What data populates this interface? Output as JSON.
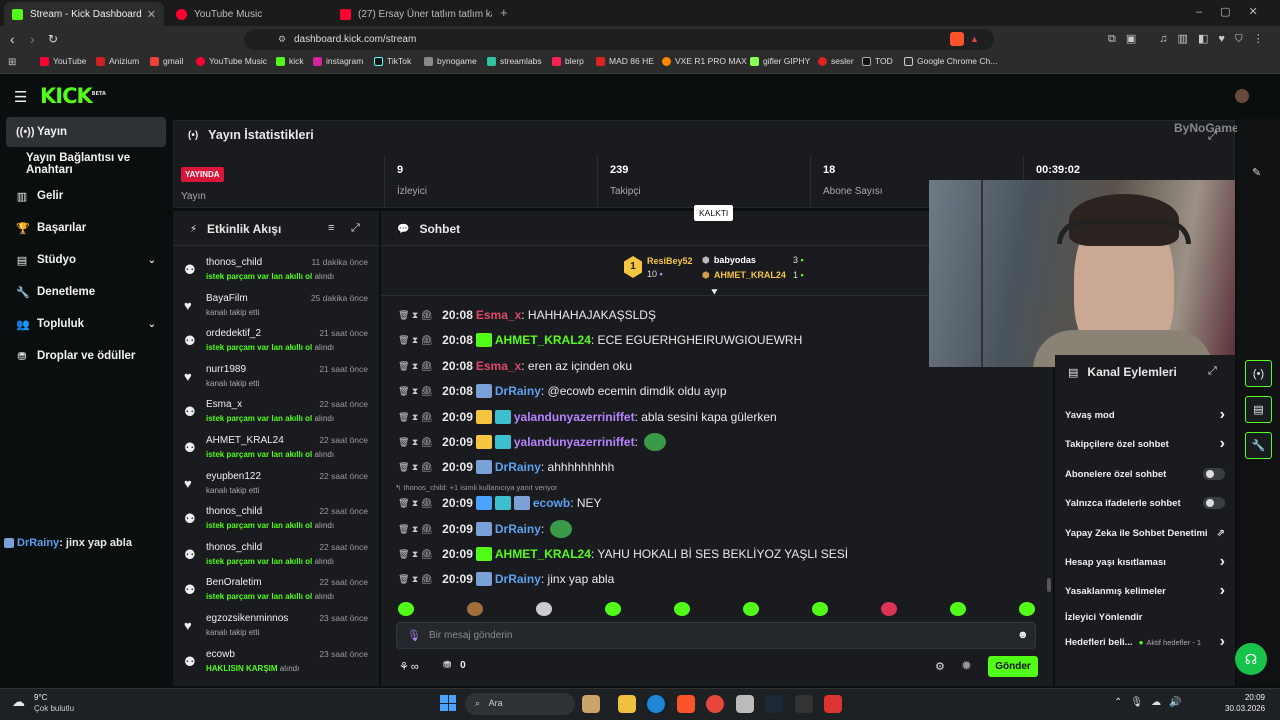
{
  "browser": {
    "tabs": [
      {
        "title": "Stream - Kick Dashboard",
        "color": "#53fc18"
      },
      {
        "title": "YouTube Music",
        "color": "#ff0033"
      },
      {
        "title": "(27) Ersay Üner tatlım tatlım karaoke",
        "color": "#ff0033"
      }
    ],
    "url": "dashboard.kick.com/stream",
    "bookmarks": [
      "YouTube",
      "Anizium",
      "gmail",
      "YouTube Music",
      "kick",
      "instagram",
      "TikTok",
      "bynogame",
      "streamlabs",
      "blerp",
      "MAD 86 HE",
      "VXE R1 PRO MAX",
      "gifler GIPHY",
      "sesler",
      "TOD",
      "Google Chrome Ch..."
    ]
  },
  "brand": {
    "logo": "KICK",
    "beta": "BETA",
    "accent": "#53fc18"
  },
  "nav": {
    "items": [
      {
        "label": "Yayın",
        "icon": "broadcast-icon"
      },
      {
        "label": "Yayın Bağlantısı ve Anahtarı",
        "icon": ""
      },
      {
        "label": "Gelir",
        "icon": "chart-icon"
      },
      {
        "label": "Başarılar",
        "icon": "trophy-icon"
      },
      {
        "label": "Stüdyo",
        "icon": "studio-icon"
      },
      {
        "label": "Denetleme",
        "icon": "wrench-icon"
      },
      {
        "label": "Topluluk",
        "icon": "community-icon"
      },
      {
        "label": "Droplar ve ödüller",
        "icon": "drops-icon"
      }
    ],
    "overlay_user": "DrRainy",
    "overlay_msg": ": jinx yap abla"
  },
  "stats": {
    "title": "Yayın İstatistikleri",
    "live_badge": "YAYINDA",
    "live_label": "Yayın",
    "viewers": "9",
    "viewers_label": "İzleyici",
    "followers": "239",
    "followers_label": "Takipçi",
    "subs": "18",
    "subs_label": "Abone Sayısı",
    "uptime": "00:39:02",
    "watermark": "ByNoGame"
  },
  "activity": {
    "title": "Etkinlik Akışı",
    "items": [
      {
        "name": "thonos_child",
        "time": "11 dakika önce",
        "prefix": "",
        "highlight": "istek parçam var lan akıllı ol",
        "suffix": " alındı",
        "kind": "reward"
      },
      {
        "name": "BayaFilm",
        "time": "25 dakika önce",
        "prefix": "kanalı takip etti",
        "highlight": "",
        "suffix": "",
        "kind": "follow"
      },
      {
        "name": "ordedektif_2",
        "time": "21 saat önce",
        "prefix": "",
        "highlight": "istek parçam var lan akıllı ol",
        "suffix": " alındı",
        "kind": "reward"
      },
      {
        "name": "nurr1989",
        "time": "21 saat önce",
        "prefix": "kanalı takip etti",
        "highlight": "",
        "suffix": "",
        "kind": "follow"
      },
      {
        "name": "Esma_x",
        "time": "22 saat önce",
        "prefix": "",
        "highlight": "istek parçam var lan akıllı ol",
        "suffix": " alındı",
        "kind": "reward"
      },
      {
        "name": "AHMET_KRAL24",
        "time": "22 saat önce",
        "prefix": "",
        "highlight": "istek parçam var lan akıllı ol",
        "suffix": " alındı",
        "kind": "reward"
      },
      {
        "name": "eyupben122",
        "time": "22 saat önce",
        "prefix": "kanalı takip etti",
        "highlight": "",
        "suffix": "",
        "kind": "follow"
      },
      {
        "name": "thonos_child",
        "time": "22 saat önce",
        "prefix": "",
        "highlight": "istek parçam var lan akıllı ol",
        "suffix": " alındı",
        "kind": "reward"
      },
      {
        "name": "thonos_child",
        "time": "22 saat önce",
        "prefix": "",
        "highlight": "istek parçam var lan akıllı ol",
        "suffix": " alındı",
        "kind": "reward"
      },
      {
        "name": "BenOraletim",
        "time": "22 saat önce",
        "prefix": "",
        "highlight": "istek parçam var lan akıllı ol",
        "suffix": " alındı",
        "kind": "reward"
      },
      {
        "name": "egzozsikenminnos",
        "time": "23 saat önce",
        "prefix": "kanalı takip etti",
        "highlight": "",
        "suffix": "",
        "kind": "follow"
      },
      {
        "name": "ecowb",
        "time": "23 saat önce",
        "prefix": "",
        "highlight": "HAKLISIN KARŞIM",
        "suffix": " alındı",
        "kind": "reward"
      }
    ]
  },
  "chat": {
    "title": "Sohbet",
    "tooltip": "KALKTI",
    "leaderboard": [
      {
        "rank": "1",
        "name": "ResiBey52",
        "count": "10",
        "color": "#f5c542"
      },
      {
        "rank": "",
        "name": "babyodas",
        "count": "3",
        "color": "#ffffff"
      },
      {
        "rank": "",
        "name": "AHMET_KRAL24",
        "count": "1",
        "color": "#f5c542"
      }
    ],
    "reply_note": "thonos_child: +1 isimli kullanıcıya yanıt veriyor",
    "messages": [
      {
        "time": "20:08",
        "user": "Esma_x",
        "color": "#e0486b",
        "text": ": HAHHAHAJAKAŞSLDŞ",
        "badges": 0
      },
      {
        "time": "20:08",
        "user": "AHMET_KRAL24",
        "color": "#53fc18",
        "text": ": ECE EGUERHGHEIRUWGIOUEWRH",
        "badges": 1
      },
      {
        "time": "20:08",
        "user": "Esma_x",
        "color": "#e0486b",
        "text": ": eren az içinden oku",
        "badges": 0
      },
      {
        "time": "20:08",
        "user": "DrRainy",
        "color": "#5da0f0",
        "text": ": @ecowb ecemin dimdik oldu ayıp",
        "badges": 1
      },
      {
        "time": "20:09",
        "user": "yalandunyazerriniffet",
        "color": "#b784ff",
        "text": ": abla sesini kapa gülerken",
        "badges": 2
      },
      {
        "time": "20:09",
        "user": "yalandunyazerriniffet",
        "color": "#b784ff",
        "text": ":",
        "badges": 2
      },
      {
        "time": "20:09",
        "user": "DrRainy",
        "color": "#5da0f0",
        "text": ": ahhhhhhhhh",
        "badges": 1
      },
      {
        "time": "20:09",
        "user": "ecowb",
        "color": "#5da0f0",
        "text": ": NEY",
        "badges": 3
      },
      {
        "time": "20:09",
        "user": "DrRainy",
        "color": "#5da0f0",
        "text": ":",
        "badges": 1
      },
      {
        "time": "20:09",
        "user": "AHMET_KRAL24",
        "color": "#53fc18",
        "text": ": YAHU HOKALI Bİ SES BEKLİYOZ YAŞLI SESİ",
        "badges": 1
      },
      {
        "time": "20:09",
        "user": "DrRainy",
        "color": "#5da0f0",
        "text": ": jinx yap abla",
        "badges": 1
      }
    ],
    "input_placeholder": "Bir mesaj gönderin",
    "points": "0",
    "send": "Gönder"
  },
  "actions": {
    "title": "Kanal Eylemleri",
    "items": [
      {
        "label": "Yavaş mod",
        "kind": "arrow"
      },
      {
        "label": "Takipçilere özel sohbet",
        "kind": "arrow"
      },
      {
        "label": "Abonelere özel sohbet",
        "kind": "toggle"
      },
      {
        "label": "Yalnızca ifadelerle sohbet",
        "kind": "toggle"
      },
      {
        "label": "Yapay Zeka ile Sohbet Denetimi",
        "kind": "ext"
      },
      {
        "label": "Hesap yaşı kısıtlaması",
        "kind": "arrow"
      },
      {
        "label": "Yasaklanmış kelimeler",
        "kind": "arrow"
      },
      {
        "label": "İzleyici Yönlendir",
        "kind": "none"
      },
      {
        "label": "Hedefleri beli...",
        "kind": "goal"
      }
    ],
    "goal_status": "Aktif hedefler - 1"
  },
  "taskbar": {
    "temp": "9°C",
    "weather": "Çok bulutlu",
    "search": "Ara",
    "time": "20:09",
    "date": "30.03.2026"
  }
}
